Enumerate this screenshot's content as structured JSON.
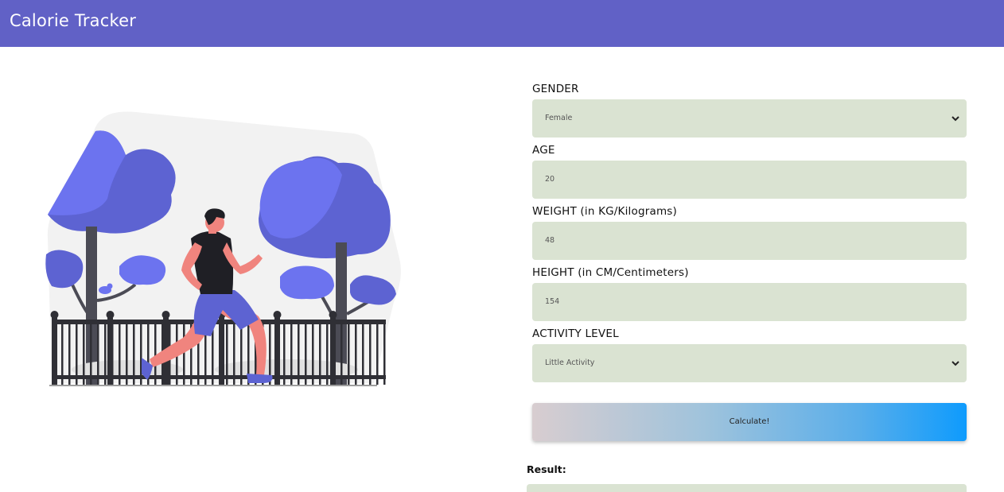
{
  "header": {
    "title": "Calorie Tracker"
  },
  "form": {
    "gender": {
      "label": "GENDER",
      "value": "Female"
    },
    "age": {
      "label": "AGE",
      "value": "20"
    },
    "weight": {
      "label": "WEIGHT (in KG/Kilograms)",
      "value": "48"
    },
    "height": {
      "label": "HEIGHT (in CM/Centimeters)",
      "value": "154"
    },
    "activity": {
      "label": "ACTIVITY LEVEL",
      "value": "Little Activity"
    },
    "calculate_label": "Calculate!",
    "result_label": "Result:"
  },
  "colors": {
    "header_bg": "#6161c6",
    "field_bg": "#dae3d2",
    "button_gradient_end": "#0e9bfd"
  },
  "icons": {
    "select_arrow": "chevron-down-icon",
    "illustration": "running-man-park-illustration"
  }
}
